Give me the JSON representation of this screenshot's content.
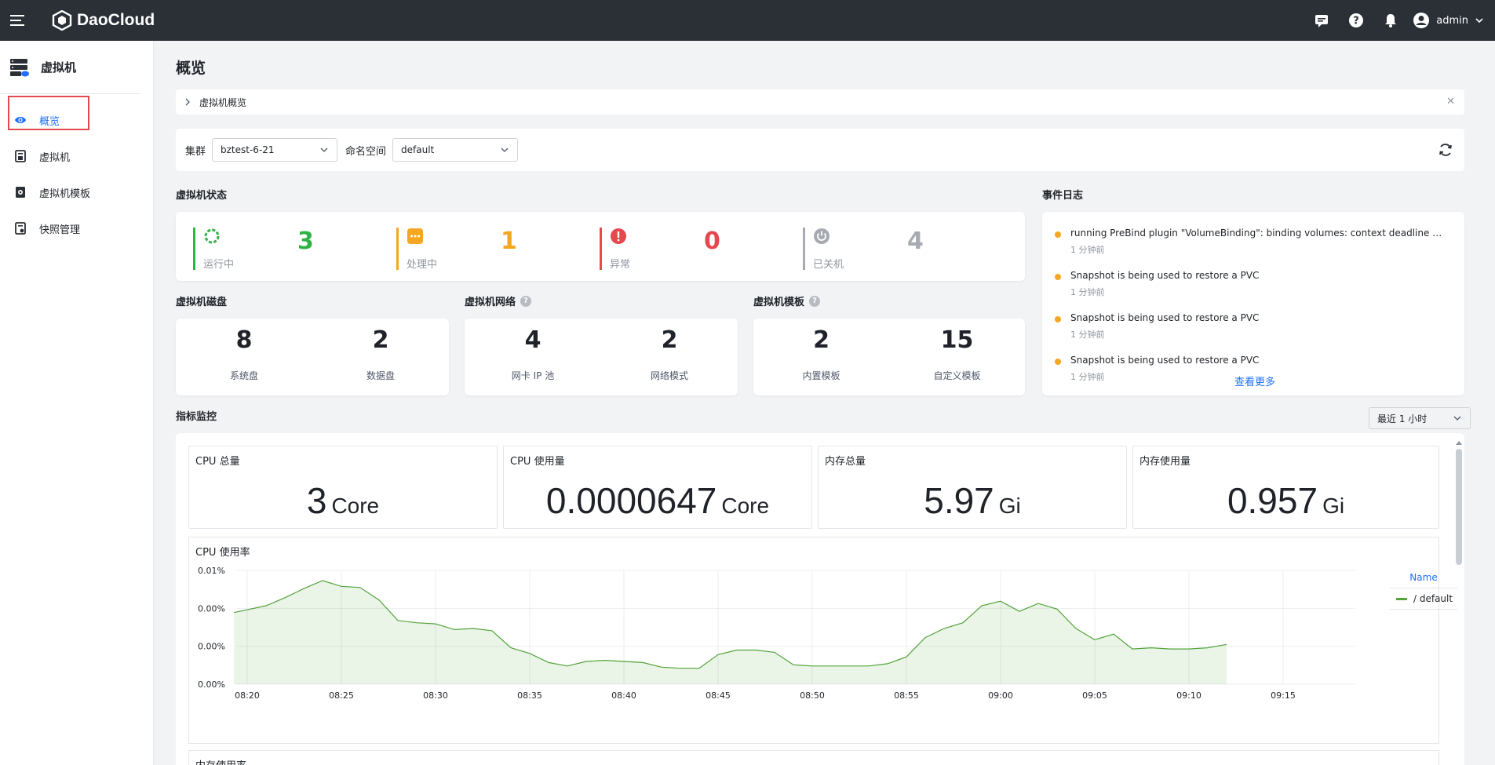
{
  "topbar": {
    "brand": "DaoCloud",
    "user": "admin",
    "icons": [
      "menu-icon",
      "message-icon",
      "help-icon",
      "bell-icon",
      "user-avatar-icon",
      "chevron-down-icon"
    ]
  },
  "sidebar": {
    "title": "虚拟机",
    "items": [
      {
        "label": "概览",
        "icon": "eye-icon",
        "active": true
      },
      {
        "label": "虚拟机",
        "icon": "vm-icon",
        "active": false
      },
      {
        "label": "虚拟机模板",
        "icon": "template-icon",
        "active": false
      },
      {
        "label": "快照管理",
        "icon": "snapshot-icon",
        "active": false
      }
    ]
  },
  "page": {
    "title": "概览",
    "breadcrumb": "虚拟机概览"
  },
  "filter": {
    "cluster_label": "集群",
    "cluster_value": "bztest-6-21",
    "namespace_label": "命名空间",
    "namespace_value": "default"
  },
  "vm_status": {
    "title": "虚拟机状态",
    "items": [
      {
        "label": "运行中",
        "value": "3",
        "color": "#2fb344"
      },
      {
        "label": "处理中",
        "value": "1",
        "color": "#f5a623"
      },
      {
        "label": "异常",
        "value": "0",
        "color": "#e5484d"
      },
      {
        "label": "已关机",
        "value": "4",
        "color": "#a7abb1"
      }
    ]
  },
  "disk": {
    "title": "虚拟机磁盘",
    "items": [
      {
        "label": "系统盘",
        "value": "8"
      },
      {
        "label": "数据盘",
        "value": "2"
      }
    ]
  },
  "network": {
    "title": "虚拟机网络",
    "items": [
      {
        "label": "网卡 IP 池",
        "value": "4"
      },
      {
        "label": "网络模式",
        "value": "2"
      }
    ]
  },
  "template": {
    "title": "虚拟机模板",
    "items": [
      {
        "label": "内置模板",
        "value": "2"
      },
      {
        "label": "自定义模板",
        "value": "15"
      }
    ]
  },
  "events": {
    "title": "事件日志",
    "items": [
      {
        "text": "running PreBind plugin \"VolumeBinding\": binding volumes: context deadline ex...",
        "time": "1 分钟前"
      },
      {
        "text": "Snapshot is being used to restore a PVC",
        "time": "1 分钟前"
      },
      {
        "text": "Snapshot is being used to restore a PVC",
        "time": "1 分钟前"
      },
      {
        "text": "Snapshot is being used to restore a PVC",
        "time": "1 分钟前"
      }
    ],
    "see_more": "查看更多"
  },
  "monitor": {
    "title": "指标监控",
    "range": "最近 1 小时",
    "cards": [
      {
        "title": "CPU 总量",
        "value": "3",
        "unit": "Core"
      },
      {
        "title": "CPU 使用量",
        "value": "0.0000647",
        "unit": "Core"
      },
      {
        "title": "内存总量",
        "value": "5.97",
        "unit": "Gi"
      },
      {
        "title": "内存使用量",
        "value": "0.957",
        "unit": "Gi"
      }
    ],
    "cpu_chart_title": "CPU 使用率",
    "mem_chart_title": "内存使用率"
  },
  "chart_data": {
    "type": "area",
    "title": "CPU 使用率",
    "y_tick_labels": [
      "0.01%",
      "0.00%",
      "0.00%",
      "0.00%"
    ],
    "x_tick_labels": [
      "08:20",
      "08:25",
      "08:30",
      "08:35",
      "08:40",
      "08:45",
      "08:50",
      "08:55",
      "09:00",
      "09:05",
      "09:10",
      "09:15"
    ],
    "x_minutes_from_0820": [
      -0.7,
      1,
      2,
      3,
      4,
      5,
      6,
      7,
      8,
      9,
      10,
      11,
      12,
      13,
      14,
      15,
      16,
      17,
      18,
      19,
      20,
      21,
      22,
      23,
      24,
      25,
      26,
      27,
      28,
      29,
      30,
      31,
      32,
      33,
      34,
      35,
      36,
      37,
      38,
      39,
      40,
      41,
      42,
      43,
      44,
      45,
      46,
      47,
      48,
      49,
      50,
      51,
      52,
      53,
      54,
      55,
      55.8
    ],
    "y_fraction_of_max": [
      0.63,
      0.69,
      0.76,
      0.84,
      0.91,
      0.86,
      0.85,
      0.74,
      0.56,
      0.54,
      0.53,
      0.48,
      0.49,
      0.47,
      0.32,
      0.27,
      0.19,
      0.16,
      0.2,
      0.21,
      0.2,
      0.19,
      0.15,
      0.14,
      0.14,
      0.26,
      0.3,
      0.3,
      0.28,
      0.17,
      0.16,
      0.16,
      0.16,
      0.16,
      0.18,
      0.24,
      0.41,
      0.49,
      0.54,
      0.69,
      0.73,
      0.64,
      0.71,
      0.66,
      0.49,
      0.39,
      0.44,
      0.31,
      0.32,
      0.31,
      0.31,
      0.32,
      0.35
    ],
    "ylim_fraction": [
      0,
      1
    ],
    "grid": true,
    "legend_title": "Name",
    "series": [
      {
        "name": "/ default",
        "color": "#52a33a"
      }
    ],
    "legend_position": "right"
  }
}
